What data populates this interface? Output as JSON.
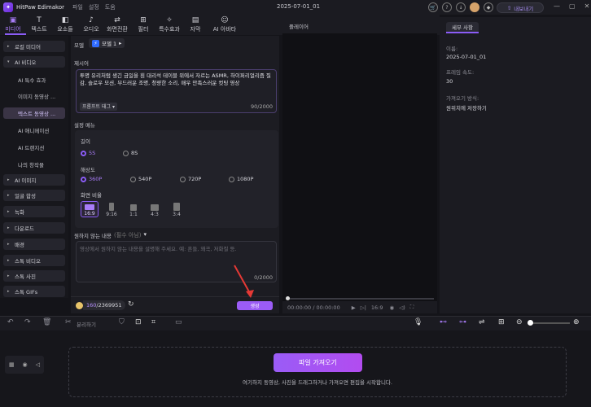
{
  "app": {
    "name": "HitPaw Edimakor",
    "menus": [
      "파일",
      "설정",
      "도움"
    ],
    "project_title": "2025-07-01_01",
    "export_label": "내보내기"
  },
  "top_tabs": [
    {
      "label": "미디어",
      "icon": "media-icon",
      "active": true
    },
    {
      "label": "텍스트",
      "icon": "text-icon"
    },
    {
      "label": "요소들",
      "icon": "elements-icon"
    },
    {
      "label": "오디오",
      "icon": "audio-icon"
    },
    {
      "label": "화면전환",
      "icon": "transition-icon"
    },
    {
      "label": "필터",
      "icon": "filter-icon"
    },
    {
      "label": "특수효과",
      "icon": "effects-icon"
    },
    {
      "label": "자막",
      "icon": "subtitle-icon"
    },
    {
      "label": "AI 아바타",
      "icon": "avatar-icon"
    }
  ],
  "sidebar": {
    "items": [
      {
        "label": "로컬 미디어",
        "type": "grp",
        "caret": "▸"
      },
      {
        "label": "AI 비디오",
        "type": "grp open",
        "caret": "▾"
      },
      {
        "label": "AI 특수 효과",
        "type": "sub"
      },
      {
        "label": "이미지 동영상 ...",
        "type": "sub"
      },
      {
        "label": "텍스트 동영상 ...",
        "type": "sub sel"
      },
      {
        "label": "AI 애니메이션",
        "type": "sub"
      },
      {
        "label": "AI 트랜지션",
        "type": "sub"
      },
      {
        "label": "나의 창작물",
        "type": "sub"
      },
      {
        "label": "AI 이미지",
        "type": "grp",
        "caret": "▸"
      },
      {
        "label": "얼굴 합성",
        "type": "grp",
        "caret": "▸"
      },
      {
        "label": "녹화",
        "type": "grp",
        "caret": "▸"
      },
      {
        "label": "다운로드",
        "type": "grp",
        "caret": "▸"
      },
      {
        "label": "배경",
        "type": "grp",
        "caret": "▸"
      },
      {
        "label": "스톡 비디오",
        "type": "grp",
        "caret": "▸"
      },
      {
        "label": "스톡 사진",
        "type": "grp",
        "caret": "▸"
      },
      {
        "label": "스톡 GIFs",
        "type": "grp",
        "caret": "▸"
      }
    ]
  },
  "generator": {
    "model_label": "모델",
    "model_value": "모델 1",
    "prompt_label": "제시어",
    "prompt_text": "투명 유리처럼 생긴 금일을 흰 대리석 테이블 위에서 자르는 ASMR, 하이퍼리얼리즘 질감, 슬로우 모션, 부드러운 조명, 청량한 소리, 매우 만족스러운 컷팅 영상",
    "prompt_tag": "프롬프트 태그",
    "prompt_count": "90/2000",
    "settings_label": "설정 메뉴",
    "duration_label": "길이",
    "durations": [
      {
        "label": "5S",
        "on": true
      },
      {
        "label": "8S",
        "on": false
      }
    ],
    "resolution_label": "해상도",
    "resolutions": [
      {
        "label": "360P",
        "on": true
      },
      {
        "label": "540P",
        "on": false
      },
      {
        "label": "720P",
        "on": false
      },
      {
        "label": "1080P",
        "on": false
      }
    ],
    "ratio_label": "화면 비율",
    "ratios": [
      {
        "label": "16:9",
        "on": true
      },
      {
        "label": "9:16"
      },
      {
        "label": "1:1"
      },
      {
        "label": "4:3"
      },
      {
        "label": "3:4"
      }
    ],
    "negative_label": "원하지 않는 내용",
    "negative_optional": "(필수 아님)",
    "negative_placeholder": "영상에서 원하지 않는 내용을 설명해 주세요. 예: 흔들, 왜곡, 저화질 등.",
    "negative_count": "0/2000",
    "credits_used": "160",
    "credits_total": "/2369951",
    "generate_label": "생성"
  },
  "player": {
    "title": "플레이어",
    "time": "00:00:00 / 00:00:00",
    "aspect": "16:9"
  },
  "details": {
    "tab": "세부 사항",
    "name_key": "이름:",
    "name_value": "2025-07-01_01",
    "fps_key": "프레임 속도:",
    "fps_value": "30",
    "save_key": "가져오기 방식:",
    "save_value": "원위치에 저장하기"
  },
  "timeline": {
    "split_label": "분리하기",
    "import_label": "파일 가져오기",
    "hint": "여기하지 동영상, 사진을 드래그하거나 가져오면 편집을 시작합니다."
  }
}
